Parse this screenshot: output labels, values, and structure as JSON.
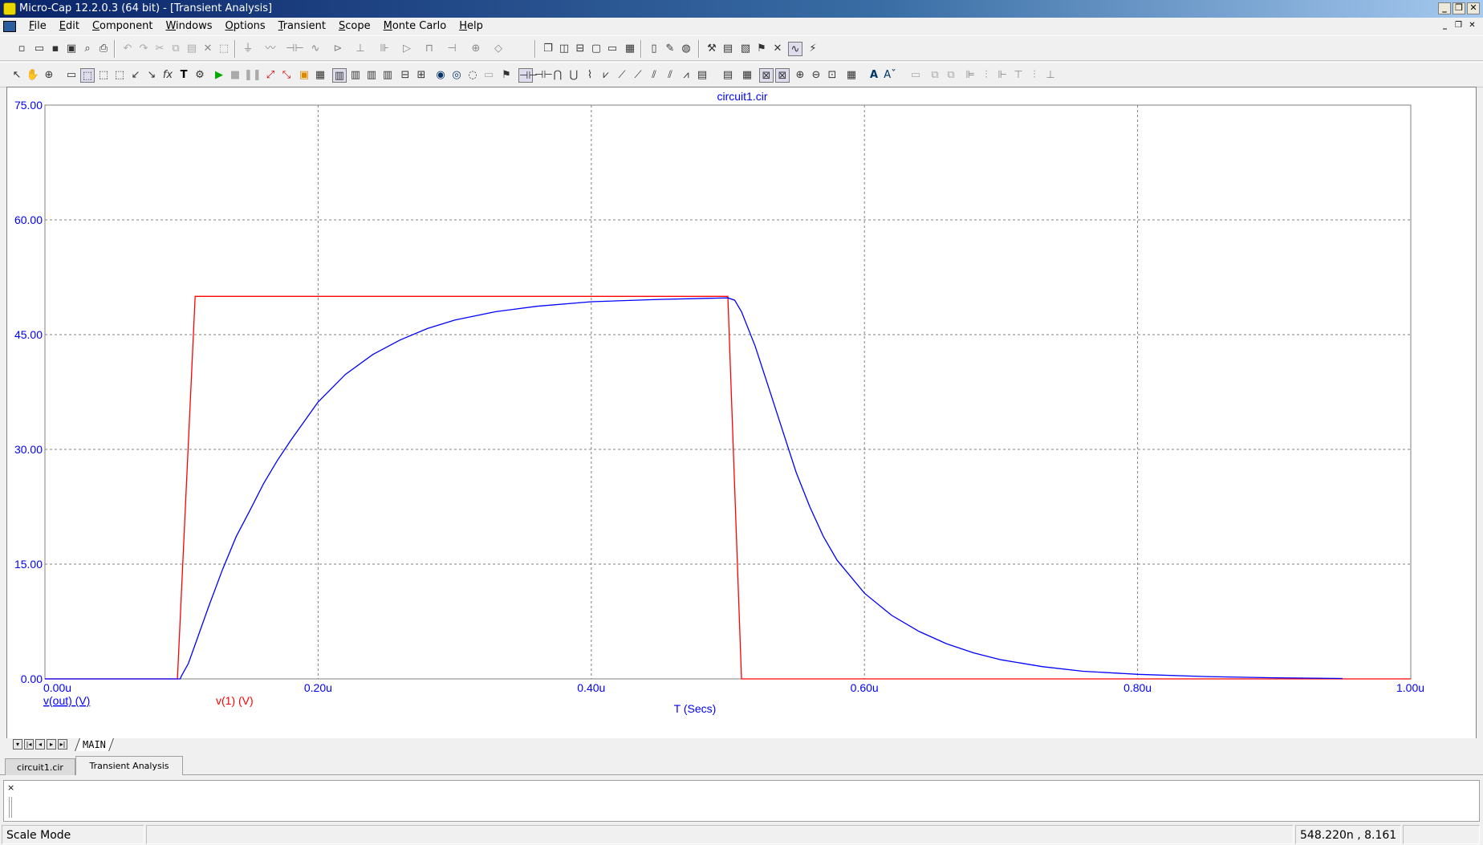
{
  "window": {
    "title": "Micro-Cap 12.2.0.3 (64 bit) - [Transient Analysis]",
    "buttons": [
      "_",
      "❒",
      "✕"
    ]
  },
  "menu": {
    "items": [
      "File",
      "Edit",
      "Component",
      "Windows",
      "Options",
      "Transient",
      "Scope",
      "Monte Carlo",
      "Help"
    ],
    "mdi_buttons": [
      "_",
      "❒",
      "✕"
    ]
  },
  "plot": {
    "title": "circuit1.cir",
    "xlabel": "T (Secs)",
    "y_ticks": [
      "75.00",
      "60.00",
      "45.00",
      "30.00",
      "15.00",
      "0.00"
    ],
    "x_ticks": [
      "0.00u",
      "0.20u",
      "0.40u",
      "0.60u",
      "0.80u",
      "1.00u"
    ],
    "legend": [
      "v(out) (V)",
      "v(1) (V)"
    ]
  },
  "chart_data": {
    "type": "line",
    "title": "circuit1.cir",
    "xlabel": "T (Secs)",
    "ylabel": "",
    "xlim": [
      0,
      1e-06
    ],
    "ylim": [
      0,
      75
    ],
    "grid": true,
    "x_tick_values": [
      0,
      2e-07,
      4e-07,
      6e-07,
      8e-07,
      1e-06
    ],
    "y_tick_values": [
      0,
      15,
      30,
      45,
      60,
      75
    ],
    "series": [
      {
        "name": "v(out) (V)",
        "color": "#0000ff",
        "x": [
          0,
          9.9e-08,
          1e-07,
          1.05e-07,
          1.1e-07,
          1.2e-07,
          1.3e-07,
          1.4e-07,
          1.5e-07,
          1.6e-07,
          1.7e-07,
          1.8e-07,
          2e-07,
          2.2e-07,
          2.4e-07,
          2.6e-07,
          2.8e-07,
          3e-07,
          3.3e-07,
          3.6e-07,
          4e-07,
          4.5e-07,
          5e-07,
          5.05e-07,
          5.1e-07,
          5.2e-07,
          5.3e-07,
          5.4e-07,
          5.5e-07,
          5.6e-07,
          5.7e-07,
          5.8e-07,
          6e-07,
          6.2e-07,
          6.4e-07,
          6.6e-07,
          6.8e-07,
          7e-07,
          7.3e-07,
          7.6e-07,
          8e-07,
          8.5e-07,
          9e-07,
          9.5e-07
        ],
        "y": [
          0,
          0,
          0.4,
          2.0,
          4.5,
          9.5,
          14.3,
          18.6,
          22.0,
          25.5,
          28.5,
          31.2,
          36.2,
          39.8,
          42.4,
          44.3,
          45.8,
          46.9,
          48.0,
          48.7,
          49.3,
          49.6,
          49.8,
          49.5,
          48.0,
          43.5,
          38.0,
          32.5,
          27.0,
          22.5,
          18.6,
          15.5,
          11.2,
          8.3,
          6.2,
          4.6,
          3.4,
          2.5,
          1.6,
          1.0,
          0.6,
          0.3,
          0.15,
          0.05
        ]
      },
      {
        "name": "v(1) (V)",
        "color": "#ff0000",
        "x": [
          0,
          9.7e-08,
          1.1e-07,
          5e-07,
          5.1e-07,
          1e-06
        ],
        "y": [
          0,
          0,
          50,
          50,
          0,
          0
        ]
      }
    ]
  },
  "sheet_tab": {
    "label": "MAIN"
  },
  "doc_tabs": [
    "circuit1.cir",
    "Transient Analysis"
  ],
  "output_panel": {
    "close_label": "×"
  },
  "status": {
    "mode": "Scale Mode",
    "cursor": "548.220n , 8.161"
  },
  "colors": {
    "v_out": "#0000ff",
    "v_1": "#ff0000",
    "axis_text": "#0000ff",
    "grid": "#808080"
  }
}
